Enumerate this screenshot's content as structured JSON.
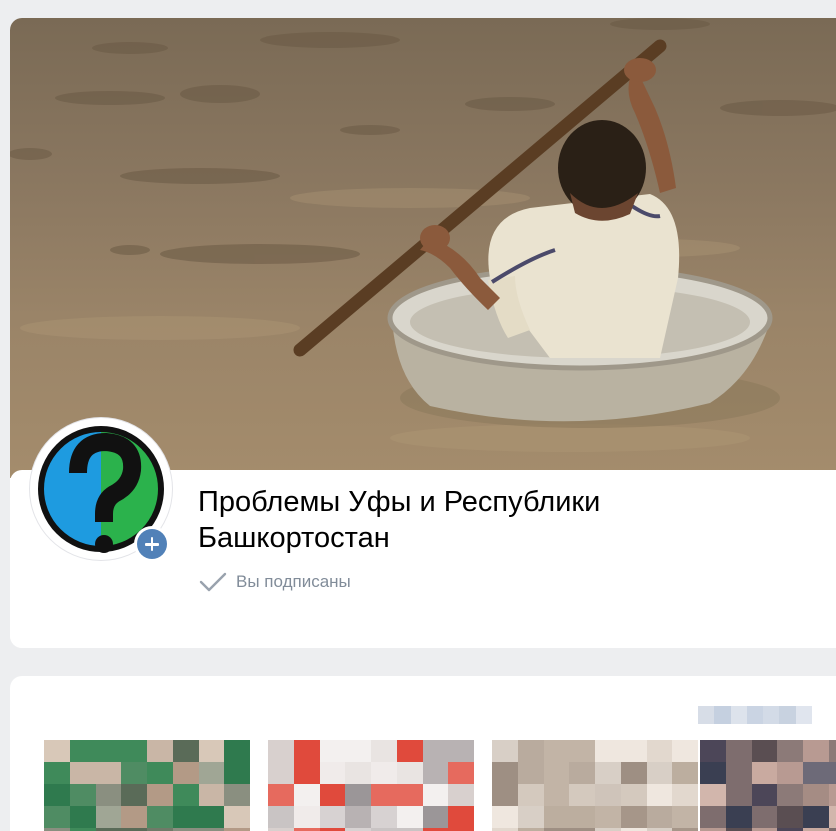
{
  "group": {
    "title": "Проблемы Уфы и Республики Башкортостан",
    "subscription_status": "Вы подписаны"
  },
  "icons": {
    "avatar": "question-mark-logo",
    "add": "plus-icon",
    "status": "checkmark-icon"
  },
  "colors": {
    "accent": "#5181b8",
    "muted_text": "#818c99",
    "page_background": "#edeef0",
    "logo_blue": "#1e9be0",
    "logo_green": "#2bb24c"
  }
}
